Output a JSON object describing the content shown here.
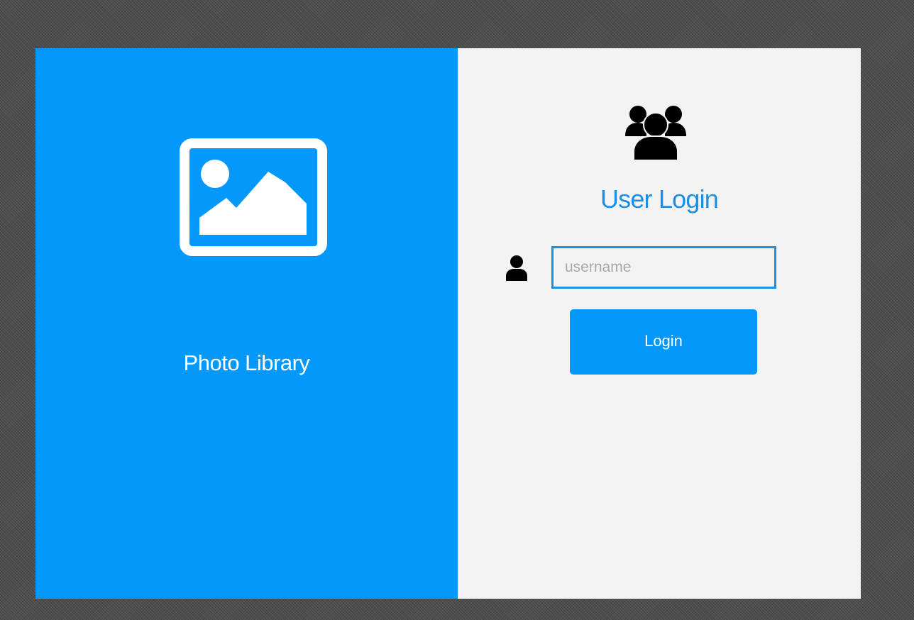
{
  "brand": {
    "icon": "image-icon",
    "title": "Photo Library"
  },
  "login": {
    "icon": "users-group-icon",
    "heading": "User Login",
    "username_icon": "user-icon",
    "username_placeholder": "username",
    "username_value": "",
    "button_label": "Login"
  },
  "colors": {
    "brand_blue": "#0598fb",
    "heading_blue": "#1a8fe3",
    "input_border": "#1792e8",
    "panel_background": "#f3f3f4",
    "backdrop": "#4d4d4d"
  }
}
